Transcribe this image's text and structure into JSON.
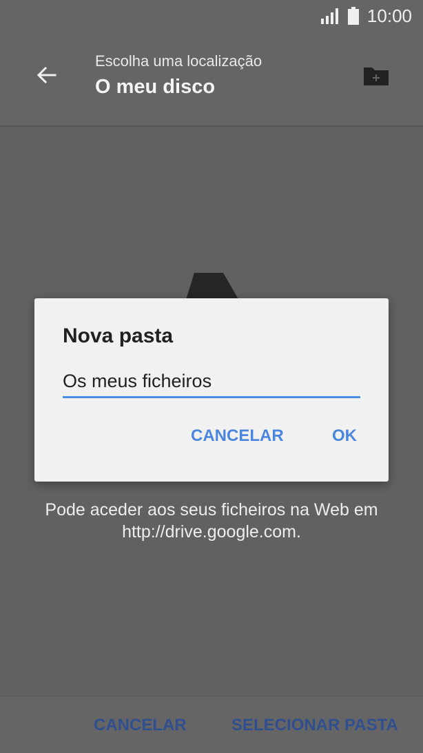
{
  "status_bar": {
    "time": "10:00",
    "icons": [
      "signal-icon",
      "battery-icon"
    ]
  },
  "toolbar": {
    "subtitle": "Escolha uma localização",
    "title": "O meu disco",
    "back_icon": "arrow-back-icon",
    "new_folder_icon": "new-folder-icon"
  },
  "content": {
    "logo_icon": "google-drive-icon",
    "empty_text": "Pode aceder aos seus ficheiros na Web em http://drive.google.com."
  },
  "bottom_bar": {
    "cancel_label": "CANCELAR",
    "select_label": "SELECIONAR PASTA"
  },
  "dialog": {
    "title": "Nova pasta",
    "input_value": "Os meus ficheiros",
    "cancel_label": "CANCELAR",
    "ok_label": "OK"
  },
  "colors": {
    "accent": "#4a86de",
    "input_underline": "#4a8fe6",
    "scrim": "#616161",
    "dialog_bg": "#f1f1f1"
  }
}
